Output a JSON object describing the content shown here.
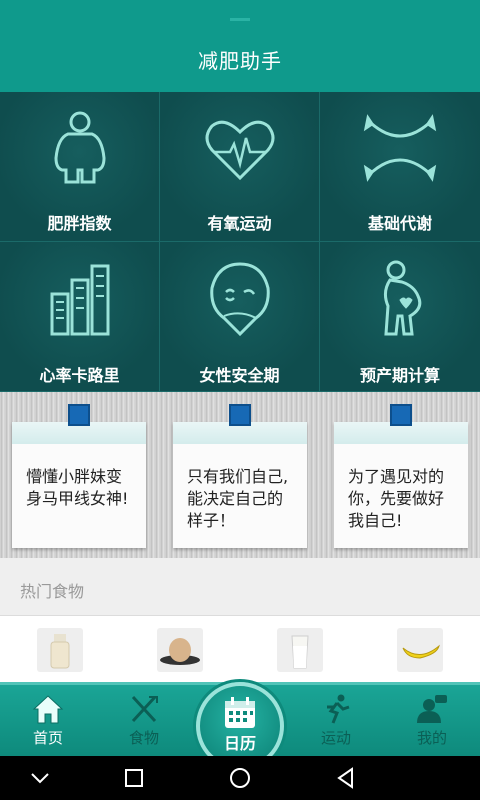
{
  "app": {
    "title": "减肥助手"
  },
  "grid": {
    "items": [
      {
        "label": "肥胖指数",
        "icon": "body-fat-icon"
      },
      {
        "label": "有氧运动",
        "icon": "heart-rate-icon"
      },
      {
        "label": "基础代谢",
        "icon": "metabolism-arrows-icon"
      },
      {
        "label": "心率卡路里",
        "icon": "ruler-chart-icon"
      },
      {
        "label": "女性安全期",
        "icon": "female-face-icon"
      },
      {
        "label": "预产期计算",
        "icon": "pregnancy-icon"
      }
    ]
  },
  "notes": [
    {
      "text": "懵懂小胖妹变身马甲线女神!"
    },
    {
      "text": "只有我们自己,能决定自己的样子！"
    },
    {
      "text": "为了遇见对的你，先要做好我自己!"
    }
  ],
  "hot_foods": {
    "title": "热门食物",
    "items": [
      "milk-bottle",
      "egg-plate",
      "milk-glass",
      "banana"
    ]
  },
  "tabbar": {
    "items": [
      {
        "label": "首页",
        "icon": "home-icon",
        "active": true
      },
      {
        "label": "食物",
        "icon": "fork-knife-icon",
        "active": false
      },
      {
        "label": "运动",
        "icon": "runner-icon",
        "active": false
      },
      {
        "label": "我的",
        "icon": "profile-icon",
        "active": false
      }
    ],
    "center": {
      "label": "日历",
      "icon": "calendar-icon"
    }
  },
  "colors": {
    "primary": "#0f9a8c",
    "grid_bg": "#0f4f50",
    "icon": "#9be3d9"
  }
}
